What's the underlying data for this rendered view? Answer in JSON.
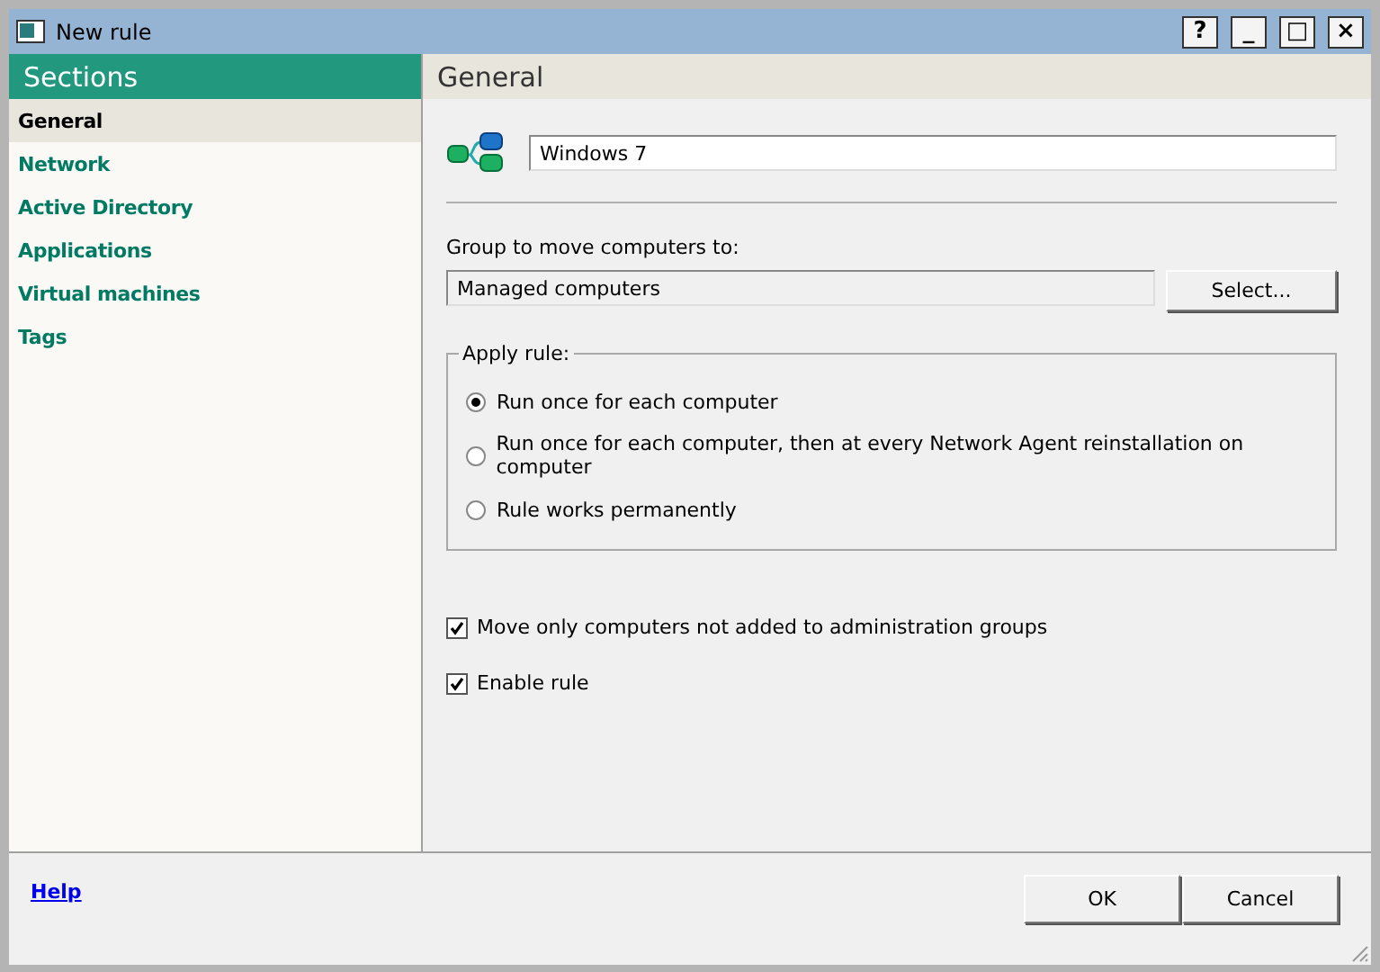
{
  "window": {
    "title": "New rule",
    "controls": [
      "?",
      "_",
      "□",
      "×"
    ]
  },
  "sidebar": {
    "title": "Sections",
    "items": [
      {
        "label": "General",
        "selected": true
      },
      {
        "label": "Network",
        "selected": false
      },
      {
        "label": "Active Directory",
        "selected": false
      },
      {
        "label": "Applications",
        "selected": false
      },
      {
        "label": "Virtual machines",
        "selected": false
      },
      {
        "label": "Tags",
        "selected": false
      }
    ]
  },
  "panel": {
    "title": "General",
    "name_value": "Windows 7",
    "group_label": "Group to move computers to:",
    "group_value": "Managed computers",
    "select_button": "Select...",
    "apply_rule": {
      "legend": "Apply rule:",
      "options": [
        {
          "label": "Run once for each computer",
          "selected": true
        },
        {
          "label": "Run once for each computer, then at every Network Agent reinstallation on computer",
          "selected": false
        },
        {
          "label": "Rule works permanently",
          "selected": false
        }
      ]
    },
    "checkboxes": [
      {
        "label": "Move only computers not added to administration groups",
        "checked": true
      },
      {
        "label": "Enable rule",
        "checked": true
      }
    ]
  },
  "footer": {
    "help": "Help",
    "buttons": [
      "OK",
      "Cancel"
    ]
  }
}
